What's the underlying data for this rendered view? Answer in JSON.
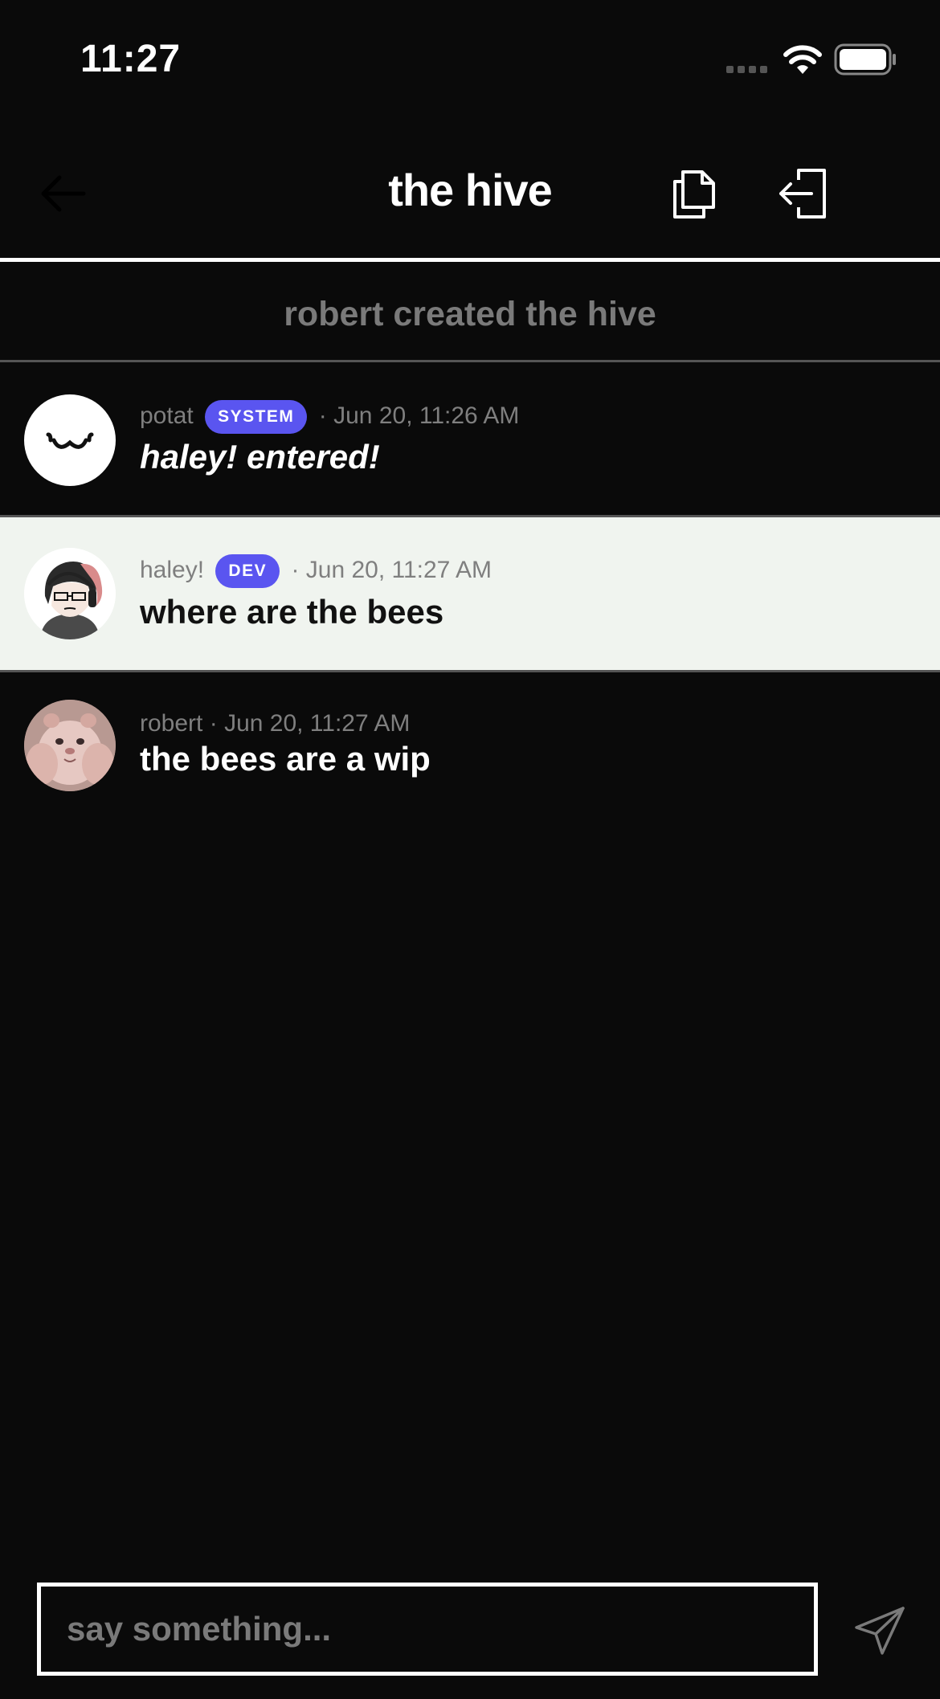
{
  "status_bar": {
    "time": "11:27",
    "icons": [
      "cellular-signal-icon",
      "wifi-icon",
      "battery-icon"
    ]
  },
  "header": {
    "title": "the hive",
    "icons": {
      "back": "arrow-left-icon",
      "copy": "copy-document-icon",
      "leave": "leave-door-icon"
    }
  },
  "notice": {
    "text": "robert created the hive"
  },
  "messages": [
    {
      "author": "potat",
      "badge": "SYSTEM",
      "separator": "·",
      "timestamp": "Jun 20, 11:26 AM",
      "text": "haley! entered!",
      "avatar": "smiley-face-avatar"
    },
    {
      "author": "haley!",
      "badge": "DEV",
      "separator": "·",
      "timestamp": "Jun 20, 11:27 AM",
      "text": "where are the bees",
      "avatar": "drawn-character-avatar"
    },
    {
      "author": "robert",
      "separator": "·",
      "timestamp": "Jun 20, 11:27 AM",
      "text": "the bees are a wip",
      "avatar": "hamster-photo-avatar"
    }
  ],
  "composer": {
    "placeholder": "say something...",
    "value": "",
    "send_icon": "paper-plane-icon"
  },
  "colors": {
    "background": "#0a0a0a",
    "badge": "#5a55f0",
    "highlight_row": "#f0f4ef",
    "muted_text": "#7f7f7f"
  }
}
